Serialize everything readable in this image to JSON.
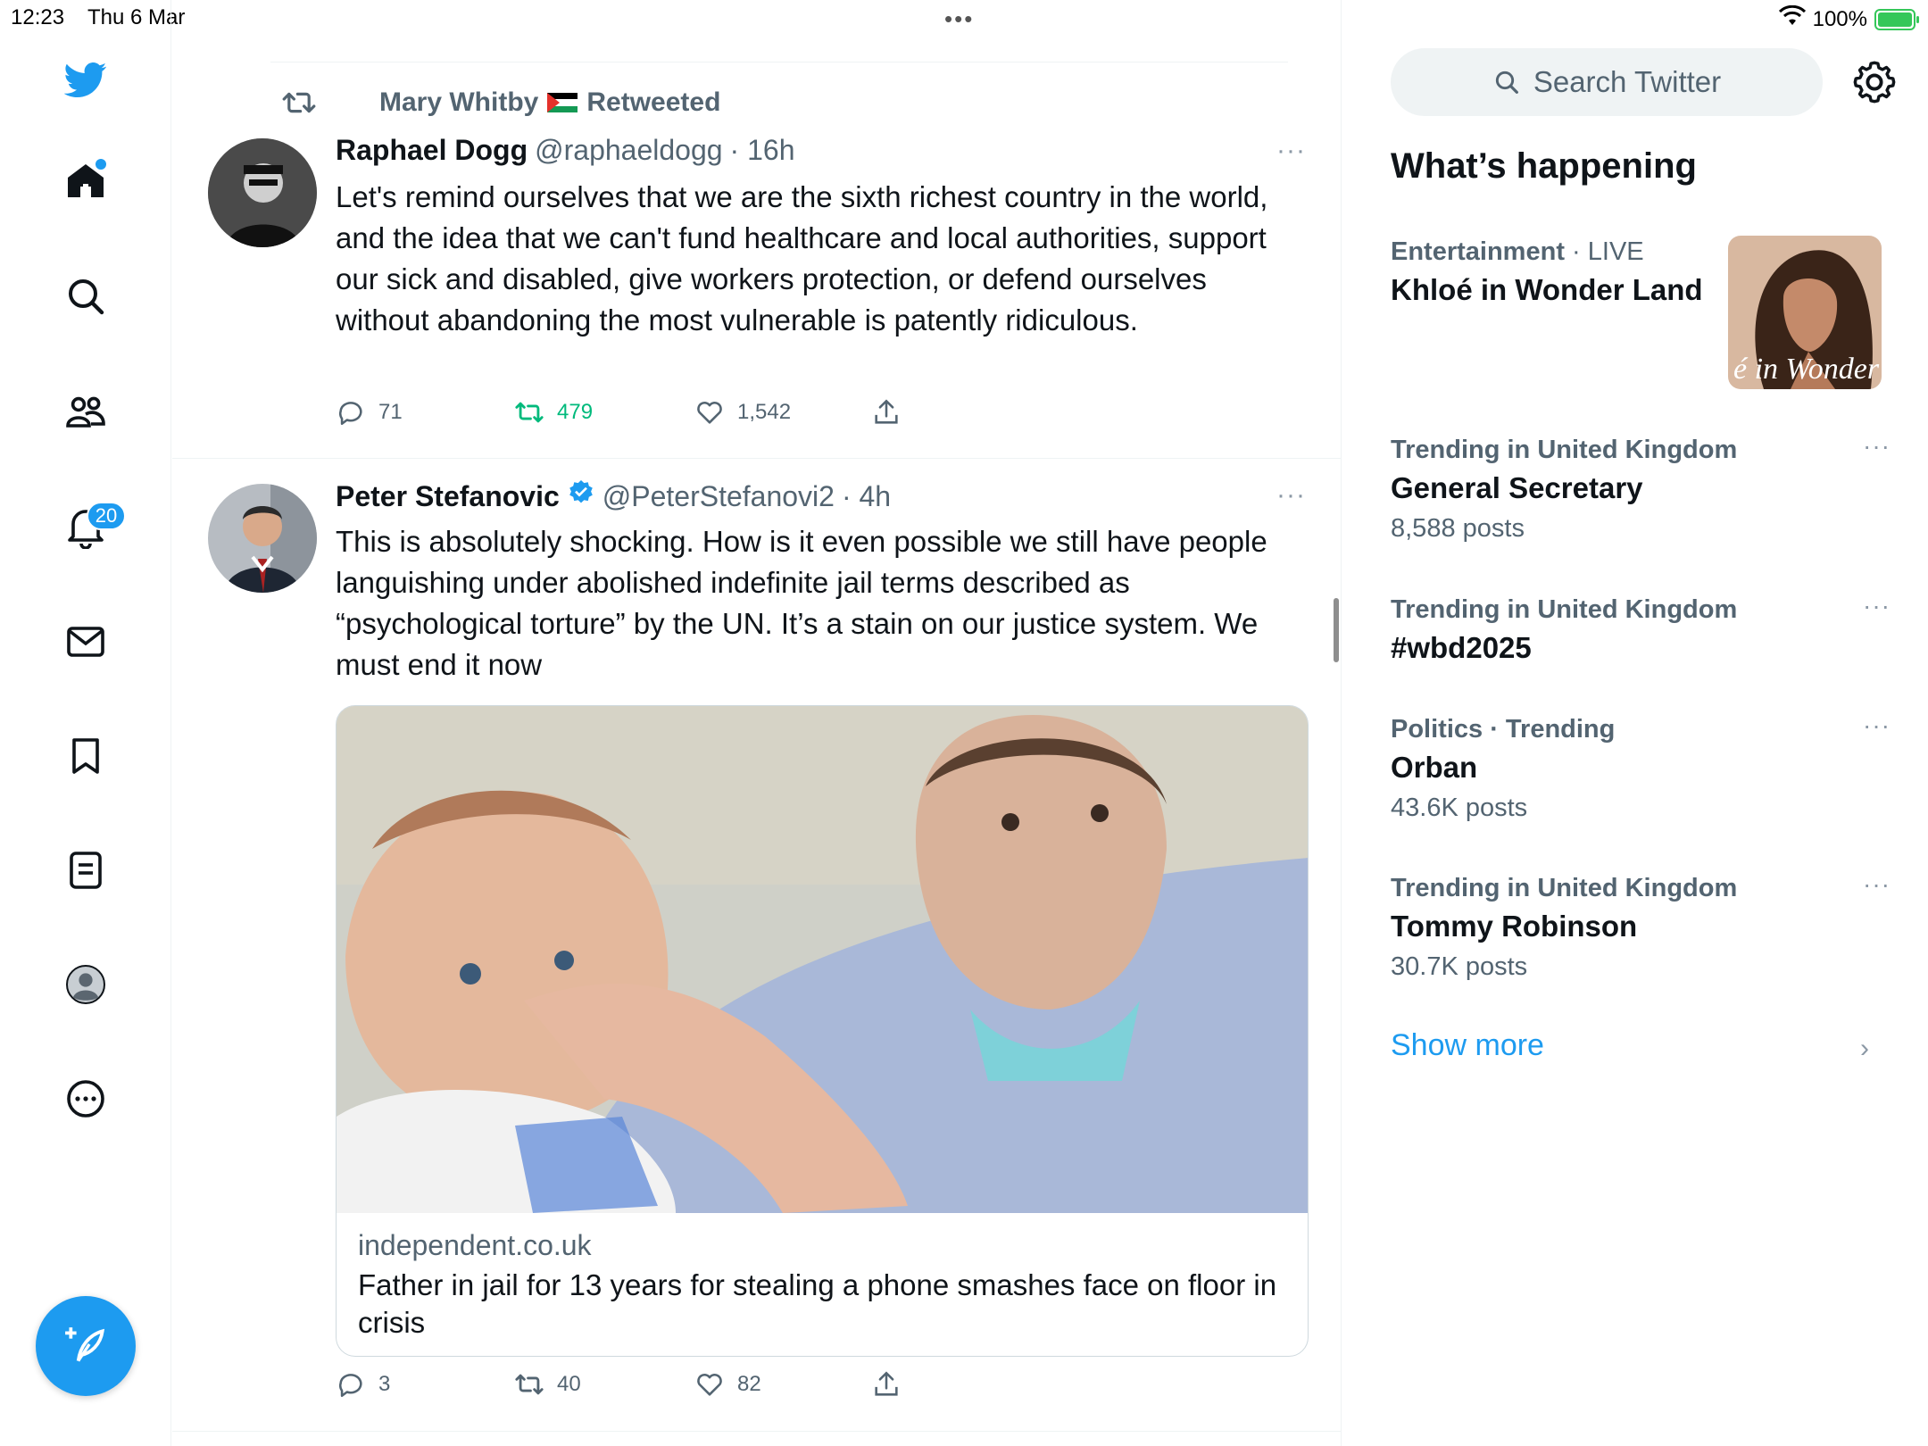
{
  "status_bar": {
    "time": "12:23",
    "date": "Thu 6 Mar",
    "grabber": "•••",
    "battery": "100%"
  },
  "nav": {
    "notifications_badge": "20"
  },
  "tweets": [
    {
      "retweeted_by": "Mary Whitby",
      "retweeted_label": "Retweeted",
      "name": "Raphael Dogg",
      "handle": "@raphaeldogg",
      "time": "· 16h",
      "more": "···",
      "text": "Let's remind ourselves that we are the sixth richest country in the world, and the idea that we can't fund healthcare and local authorities, support our sick and disabled, give workers protection, or defend ourselves without abandoning the most vulnerable is patently ridiculous.",
      "replies": "71",
      "retweets": "479",
      "likes": "1,542"
    },
    {
      "name": "Peter Stefanovic",
      "verified": true,
      "handle": "@PeterStefanovi2",
      "time": "· 4h",
      "more": "···",
      "text": "This is absolutely shocking. How is it even possible we still have people languishing under abolished indefinite jail terms described as “psychological torture” by the UN. It’s a stain on our justice system. We must end it now",
      "card_domain": "independent.co.uk",
      "card_title": "Father in jail for 13 years for stealing a phone smashes face on floor in crisis",
      "replies": "3",
      "retweets": "40",
      "likes": "82"
    }
  ],
  "sidebar": {
    "search_placeholder": "Search Twitter",
    "heading": "What’s happening",
    "trends": [
      {
        "category": "Entertainment",
        "suffix": "· LIVE",
        "title": "Khloé in Wonder Land",
        "image_text": "é in Wonder L"
      },
      {
        "category": "Trending in United Kingdom",
        "title": "General Secretary",
        "count": "8,588 posts"
      },
      {
        "category": "Trending in United Kingdom",
        "title": "#wbd2025"
      },
      {
        "category": "Politics · Trending",
        "title": "Orban",
        "count": "43.6K posts"
      },
      {
        "category": "Trending in United Kingdom",
        "title": "Tommy Robinson",
        "count": "30.7K posts"
      }
    ],
    "trend_more": "···",
    "show_more": "Show more",
    "chevron": "›"
  },
  "colors": {
    "accent": "#1d9bf0",
    "retweet_green": "#00ba7c",
    "muted": "#536471"
  }
}
